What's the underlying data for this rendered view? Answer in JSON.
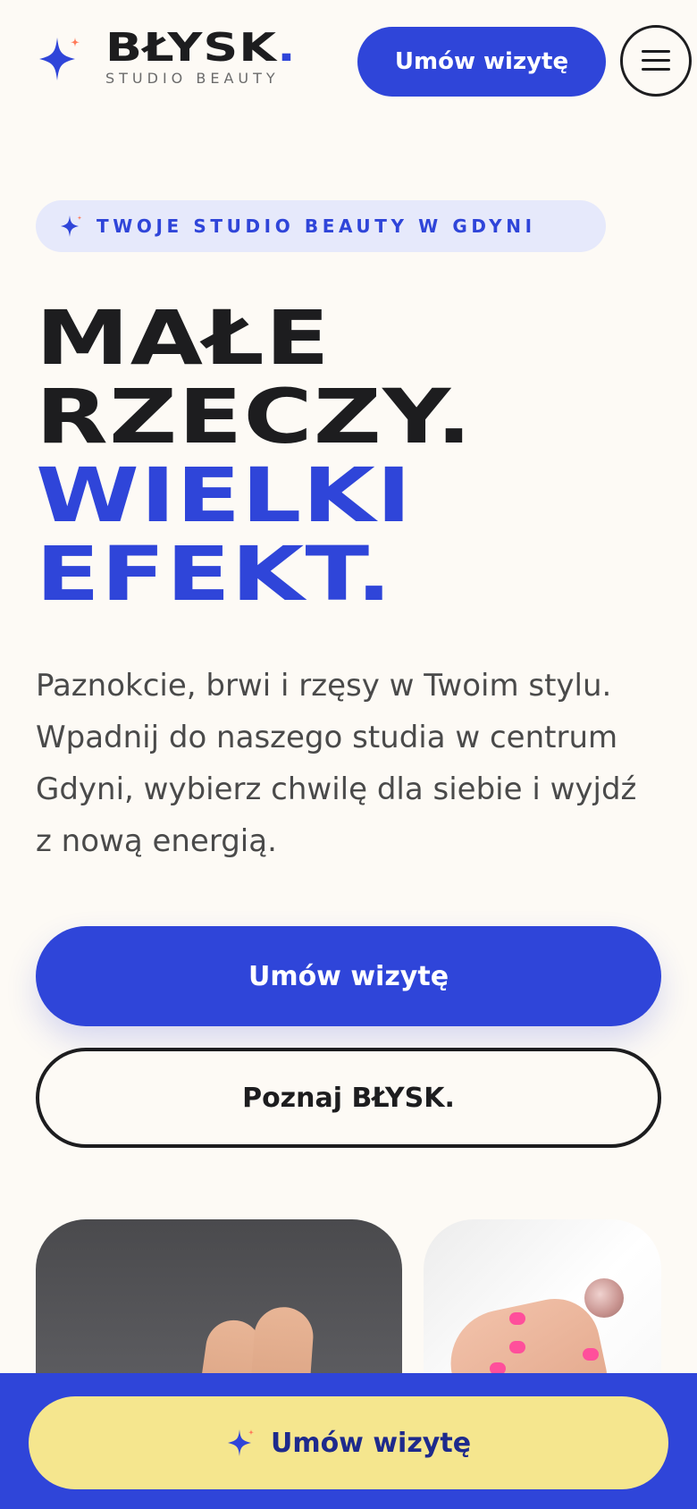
{
  "header": {
    "brand_name": "BŁYSK",
    "brand_dot": ".",
    "brand_sub": "STUDIO BEAUTY",
    "cta_label": "Umów wizytę",
    "menu_icon": "hamburger-icon",
    "logo_icon": "sparkle-icon"
  },
  "hero": {
    "tagline": "TWOJE STUDIO BEAUTY W GDYNI",
    "tagline_icon": "sparkle-icon",
    "line1": "MAŁE",
    "line2": "RZECZY.",
    "line3": "WIELKI",
    "line4": "EFEKT.",
    "lead": "Paznokcie, brwi i rzęsy w Twoim stylu. Wpadnij do naszego studia w centrum Gdyni, wybierz chwilę dla siebie i wyjdź z nową energią.",
    "cta_primary": "Umów wizytę",
    "cta_secondary": "Poznaj BŁYSK."
  },
  "sticky": {
    "cta_label": "Umów wizytę",
    "cta_icon": "sparkle-icon"
  },
  "colors": {
    "accent": "#2f45d9",
    "background": "#fdfaf5",
    "text": "#1d1d1f",
    "sticky_button": "#f5e68e",
    "tag_bg": "#e6e9fb",
    "star_highlight": "#ff7a59"
  }
}
